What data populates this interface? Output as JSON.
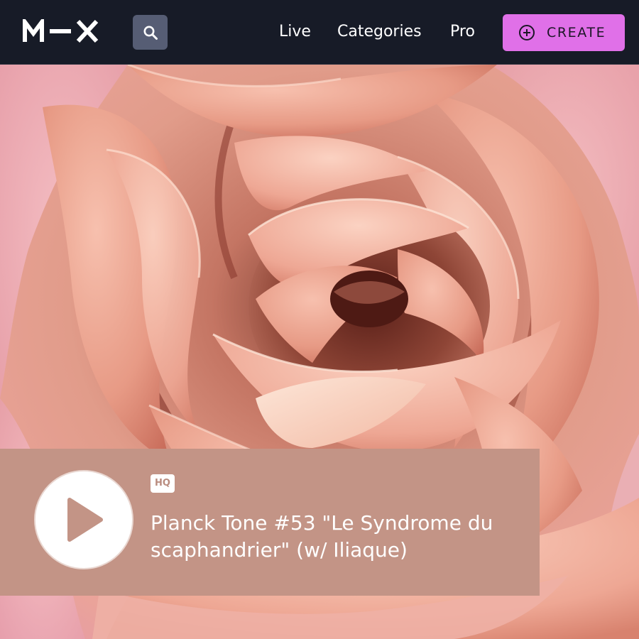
{
  "nav": {
    "logo_text": "M—X",
    "search_icon": "search-icon",
    "links": [
      "Live",
      "Categories",
      "Pro"
    ],
    "create_label": "CREATE",
    "create_icon": "plus-circle-icon",
    "colors": {
      "bar": "#171b27",
      "search_bg": "#565d74",
      "create_bg": "#e070e8"
    }
  },
  "hero": {
    "image": "pink-rose-closeup"
  },
  "player": {
    "badge": "HQ",
    "title": "Planck Tone #53 \"Le Syndrome du scaphandrier\" (w/ Iliaque)",
    "play_icon": "play-icon",
    "colors": {
      "card_bg": "#c39486",
      "play_triangle": "#c39486"
    }
  }
}
